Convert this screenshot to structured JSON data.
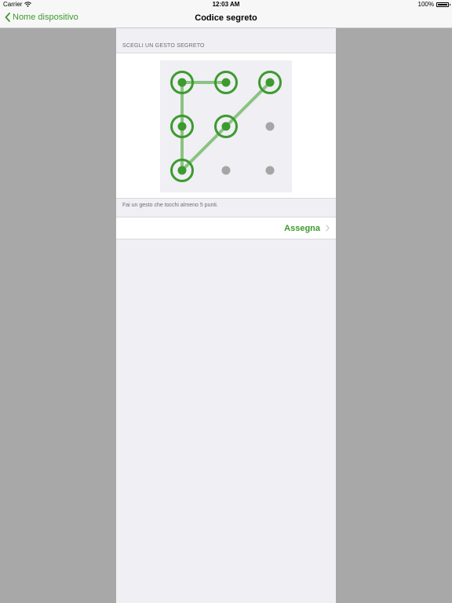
{
  "status_bar": {
    "carrier": "Carrier",
    "time": "12:03 AM",
    "battery": "100%",
    "battery_level": 1.0
  },
  "nav": {
    "back_label": "Nome dispositivo",
    "title": "Codice segreto"
  },
  "section_header": "SCEGLI UN GESTO SEGRETO",
  "gesture": {
    "grid": [
      3,
      3
    ],
    "selected_sequence": [
      [
        1,
        0
      ],
      [
        0,
        0
      ],
      [
        0,
        1
      ],
      [
        0,
        2
      ],
      [
        1,
        1
      ],
      [
        2,
        0
      ]
    ],
    "note_unused": "points listed as [col,row]"
  },
  "footer_note": "Fai un gesto che tocchi almeno 5 punti.",
  "assign_label": "Assegna",
  "colors": {
    "accent": "#3d9a2e",
    "accent_line": "#8bc382",
    "inactive_dot": "#a5a5a5",
    "background": "#efeff4",
    "outer": "#a8a8a8"
  }
}
